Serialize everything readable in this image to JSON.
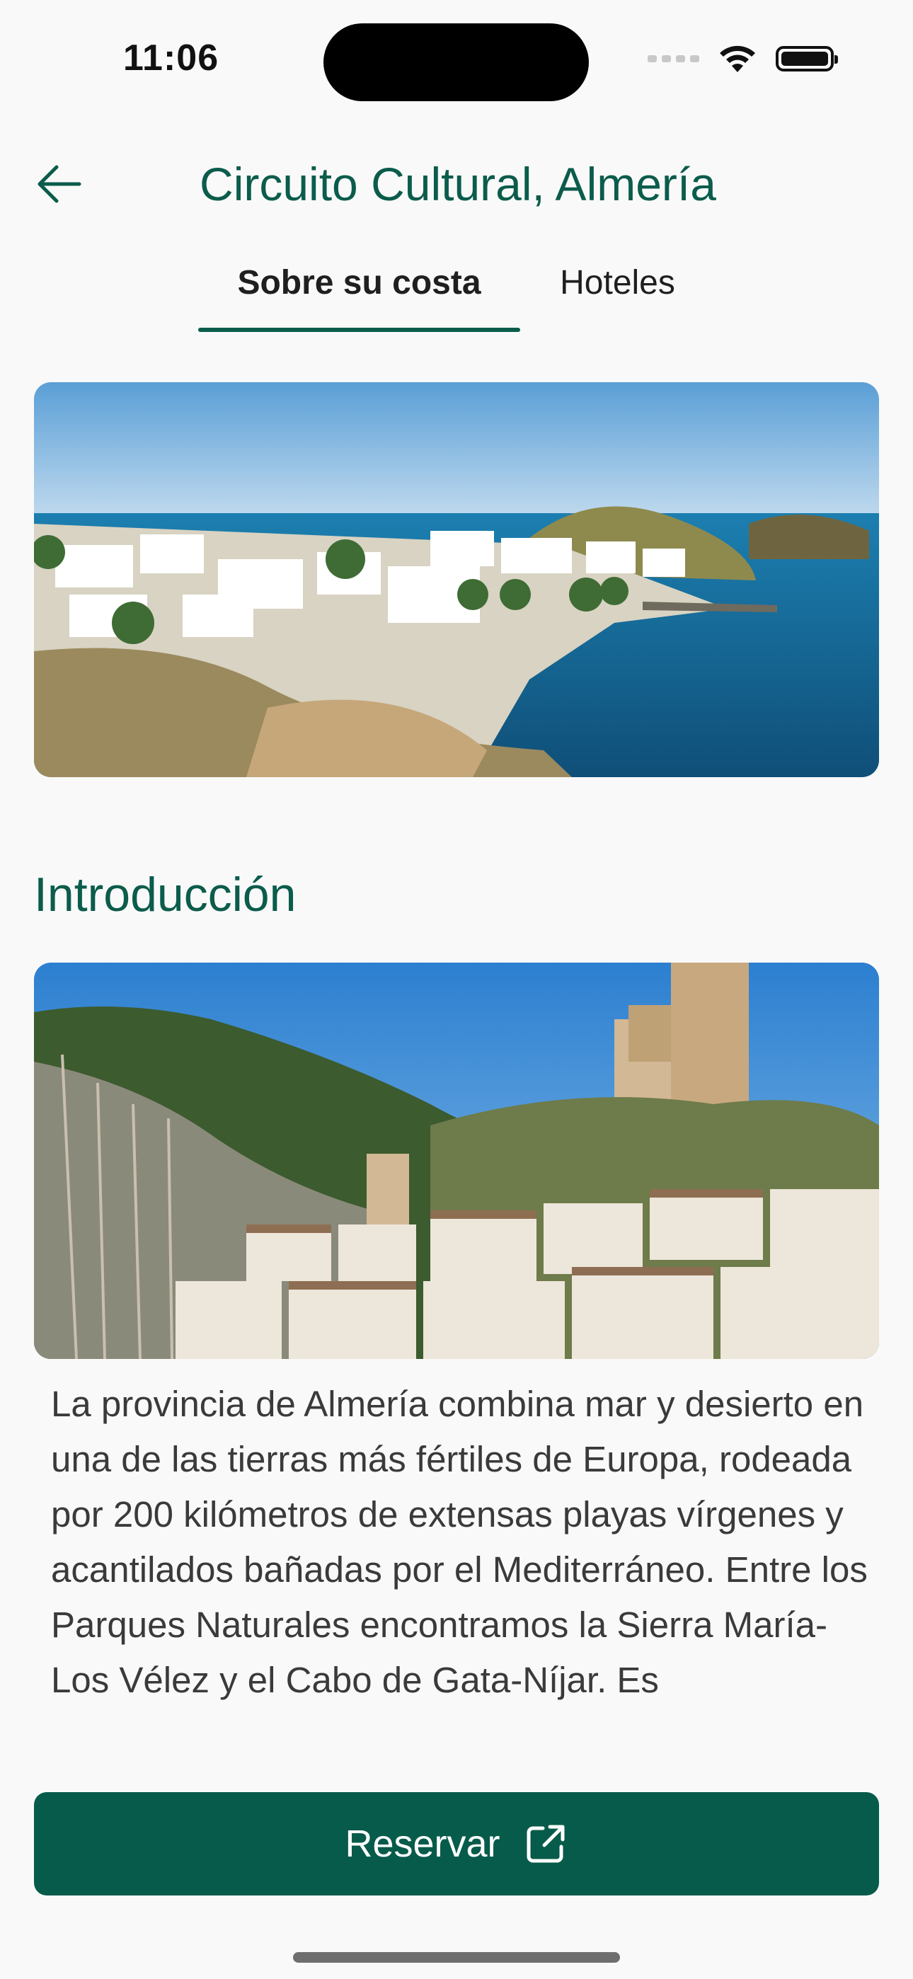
{
  "status_bar": {
    "time": "11:06"
  },
  "header": {
    "title": "Circuito Cultural, Almería"
  },
  "tabs": [
    {
      "label": "Sobre su costa",
      "active": true
    },
    {
      "label": "Hoteles",
      "active": false
    }
  ],
  "content": {
    "section_heading": "Introducción",
    "intro_text": "La provincia de Almería combina mar y desierto en una de las tierras más fértiles de Europa, rodeada por 200 kilómetros de extensas playas vírgenes y acantilados bañadas por el Mediterráneo. Entre los Parques Naturales encontramos la Sierra María-Los Vélez y el Cabo de Gata-Níjar. Es"
  },
  "actions": {
    "reserve_label": "Reservar"
  },
  "colors": {
    "accent": "#0B5C4B",
    "button_bg": "#075B4A",
    "background": "#F9F9F9"
  },
  "icons": {
    "back": "arrow-left-icon",
    "reserve": "external-link-icon"
  }
}
